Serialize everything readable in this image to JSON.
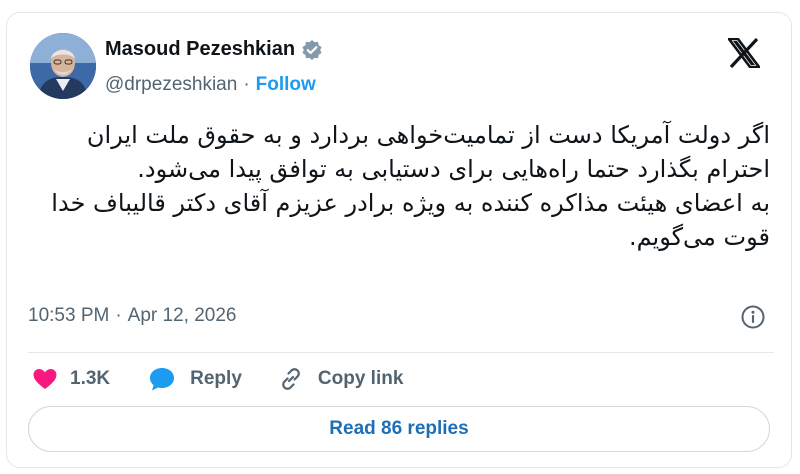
{
  "author": {
    "display_name": "Masoud Pezeshkian",
    "handle": "@drpezeshkian",
    "separator": "·",
    "follow_label": "Follow",
    "verified": true
  },
  "tweet": {
    "paragraph_1": "اگر دولت آمریکا دست از تمامیت‌خواهی بردارد و به حقوق ملت ایران احترام بگذارد حتما راه‌هایی برای دستیابی به توافق پیدا می‌شود.",
    "paragraph_2": "به اعضای هیئت مذاکره کننده به ویژه برادر عزیزم آقای دکتر قالیباف خدا قوت می‌گویم."
  },
  "meta": {
    "time": "10:53 PM",
    "separator": "·",
    "date": "Apr 12, 2026"
  },
  "actions": {
    "like_count": "1.3K",
    "reply_label": "Reply",
    "copy_link_label": "Copy link"
  },
  "read_replies_label": "Read 86 replies",
  "icons": {
    "logo": "x-logo-icon",
    "verified": "verified-badge-icon",
    "like": "heart-icon",
    "reply": "speech-bubble-icon",
    "copy": "link-icon",
    "info": "info-icon"
  },
  "colors": {
    "accent": "#1d9bf0",
    "like": "#f91880",
    "muted": "#536471",
    "verified_badge": "#829aab"
  }
}
